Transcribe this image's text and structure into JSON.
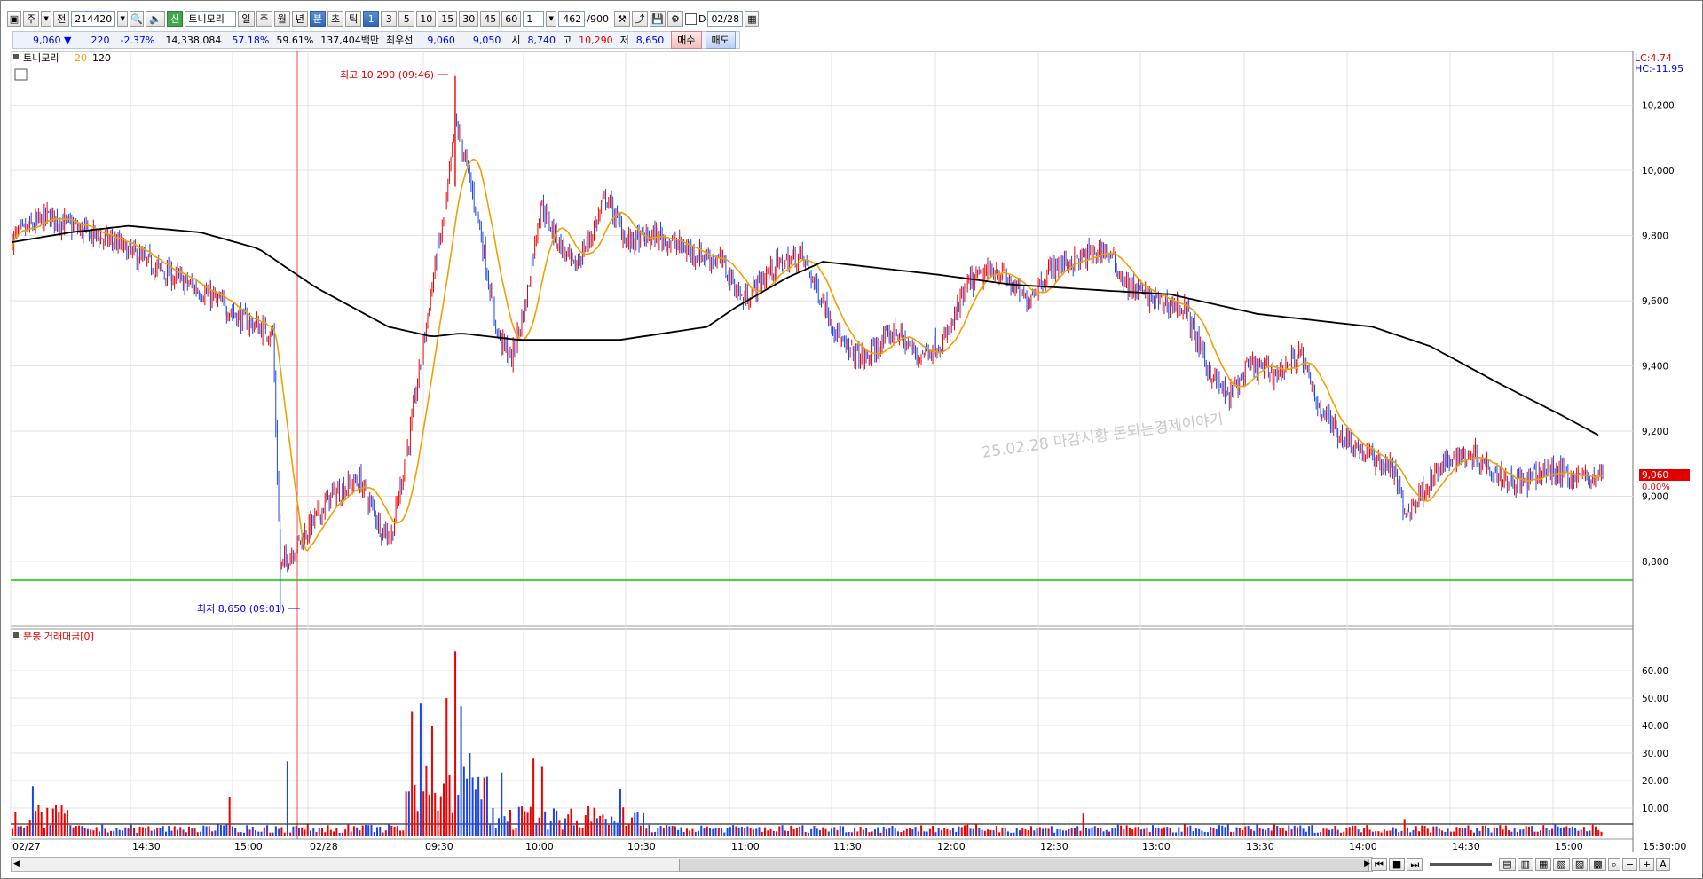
{
  "toolbar": {
    "tab_stock": "주",
    "tab_all": "전",
    "code": "214420",
    "stock_badge": "신",
    "stock_name": "토니모리",
    "periods": [
      "일",
      "주",
      "월",
      "년",
      "분",
      "초",
      "틱"
    ],
    "active_period": "분",
    "minutes": [
      "1",
      "3",
      "5",
      "10",
      "15",
      "30",
      "45",
      "60"
    ],
    "active_minute": "1",
    "unit": "1",
    "count": "462",
    "count_max": "/900",
    "date_label": "D",
    "date": "02/28"
  },
  "quote": {
    "price": "9,060",
    "change": "220",
    "change_pct": "-2.37%",
    "volume": "14,338,084",
    "ratio1": "57.18%",
    "ratio2": "59.61%",
    "amount": "137,404백만",
    "best_label": "최우선",
    "ask": "9,060",
    "bid": "9,050",
    "open_label": "시",
    "open": "8,740",
    "high_label": "고",
    "high": "10,290",
    "low_label": "저",
    "low": "8,650",
    "buy_label": "매수",
    "sell_label": "매도"
  },
  "panels": {
    "price_legend": "토니모리",
    "ma20": "20",
    "ma120": "120",
    "volume_legend": "분봉 거래대금[0]",
    "lc": "LC:4.74",
    "hc": "HC:-11.95",
    "high_marker": "최고 10,290 (09:46)",
    "low_marker": "최저 8,650 (09:01)",
    "watermark": "25.02.28 마감시황 돈되는경제이야기",
    "last_price": "9,060",
    "last_pct": "0.00%",
    "end_time": "15:30:00"
  },
  "colors": {
    "up": "#ee0000",
    "down": "#1a44e6",
    "ma20": "#f0a000",
    "ma120": "#000000",
    "support": "#00cc00"
  },
  "chart_data": {
    "type": "candlestick",
    "price_axis": {
      "min": 8650,
      "max": 10300,
      "ticks": [
        "8,800",
        "9,000",
        "9,200",
        "9,400",
        "9,600",
        "9,800",
        "10,000",
        "10,200"
      ]
    },
    "volume_axis": {
      "min": 0,
      "max": 70,
      "ticks": [
        "10.00",
        "20.00",
        "30.00",
        "40.00",
        "50.00",
        "60.00"
      ]
    },
    "time_labels": [
      "02/27",
      "14:30",
      "15:00",
      "02/28",
      "09:30",
      "10:00",
      "10:30",
      "11:00",
      "11:30",
      "12:00",
      "12:30",
      "13:00",
      "13:30",
      "14:00",
      "14:30",
      "15:00"
    ],
    "support_level": 8740,
    "high": 10290,
    "low": 8650,
    "keyframes": [
      {
        "t": 0,
        "p": 9790
      },
      {
        "t": 10,
        "p": 9820
      },
      {
        "t": 25,
        "p": 9860
      },
      {
        "t": 45,
        "p": 9820
      },
      {
        "t": 70,
        "p": 9780
      },
      {
        "t": 100,
        "p": 9700
      },
      {
        "t": 135,
        "p": 9620
      },
      {
        "t": 160,
        "p": 9540
      },
      {
        "t": 180,
        "p": 9500
      },
      {
        "t": 185,
        "p": 8780
      },
      {
        "t": 200,
        "p": 8870
      },
      {
        "t": 220,
        "p": 9000
      },
      {
        "t": 240,
        "p": 9050
      },
      {
        "t": 255,
        "p": 8900
      },
      {
        "t": 262,
        "p": 8880
      },
      {
        "t": 275,
        "p": 9200
      },
      {
        "t": 290,
        "p": 9650
      },
      {
        "t": 300,
        "p": 9900
      },
      {
        "t": 306,
        "p": 10150
      },
      {
        "t": 312,
        "p": 10050
      },
      {
        "t": 322,
        "p": 9850
      },
      {
        "t": 335,
        "p": 9500
      },
      {
        "t": 345,
        "p": 9420
      },
      {
        "t": 355,
        "p": 9600
      },
      {
        "t": 365,
        "p": 9900
      },
      {
        "t": 375,
        "p": 9800
      },
      {
        "t": 388,
        "p": 9700
      },
      {
        "t": 400,
        "p": 9800
      },
      {
        "t": 410,
        "p": 9920
      },
      {
        "t": 425,
        "p": 9780
      },
      {
        "t": 445,
        "p": 9800
      },
      {
        "t": 470,
        "p": 9750
      },
      {
        "t": 490,
        "p": 9720
      },
      {
        "t": 505,
        "p": 9600
      },
      {
        "t": 525,
        "p": 9700
      },
      {
        "t": 545,
        "p": 9740
      },
      {
        "t": 560,
        "p": 9600
      },
      {
        "t": 575,
        "p": 9450
      },
      {
        "t": 590,
        "p": 9420
      },
      {
        "t": 610,
        "p": 9510
      },
      {
        "t": 625,
        "p": 9430
      },
      {
        "t": 645,
        "p": 9480
      },
      {
        "t": 660,
        "p": 9650
      },
      {
        "t": 680,
        "p": 9700
      },
      {
        "t": 700,
        "p": 9600
      },
      {
        "t": 720,
        "p": 9710
      },
      {
        "t": 740,
        "p": 9730
      },
      {
        "t": 755,
        "p": 9760
      },
      {
        "t": 770,
        "p": 9650
      },
      {
        "t": 790,
        "p": 9600
      },
      {
        "t": 810,
        "p": 9580
      },
      {
        "t": 825,
        "p": 9400
      },
      {
        "t": 840,
        "p": 9300
      },
      {
        "t": 855,
        "p": 9400
      },
      {
        "t": 875,
        "p": 9380
      },
      {
        "t": 890,
        "p": 9440
      },
      {
        "t": 900,
        "p": 9300
      },
      {
        "t": 915,
        "p": 9200
      },
      {
        "t": 935,
        "p": 9130
      },
      {
        "t": 955,
        "p": 9080
      },
      {
        "t": 962,
        "p": 8940
      },
      {
        "t": 980,
        "p": 9050
      },
      {
        "t": 995,
        "p": 9120
      },
      {
        "t": 1010,
        "p": 9130
      },
      {
        "t": 1030,
        "p": 9060
      },
      {
        "t": 1045,
        "p": 9040
      },
      {
        "t": 1060,
        "p": 9080
      },
      {
        "t": 1080,
        "p": 9060
      },
      {
        "t": 1099,
        "p": 9060
      }
    ],
    "ma120_keyframes": [
      {
        "t": 0,
        "p": 9780
      },
      {
        "t": 40,
        "p": 9810
      },
      {
        "t": 80,
        "p": 9830
      },
      {
        "t": 130,
        "p": 9810
      },
      {
        "t": 170,
        "p": 9760
      },
      {
        "t": 210,
        "p": 9640
      },
      {
        "t": 260,
        "p": 9520
      },
      {
        "t": 290,
        "p": 9490
      },
      {
        "t": 310,
        "p": 9500
      },
      {
        "t": 350,
        "p": 9480
      },
      {
        "t": 420,
        "p": 9480
      },
      {
        "t": 480,
        "p": 9520
      },
      {
        "t": 500,
        "p": 9580
      },
      {
        "t": 535,
        "p": 9670
      },
      {
        "t": 560,
        "p": 9720
      },
      {
        "t": 600,
        "p": 9700
      },
      {
        "t": 640,
        "p": 9680
      },
      {
        "t": 690,
        "p": 9650
      },
      {
        "t": 760,
        "p": 9630
      },
      {
        "t": 800,
        "p": 9620
      },
      {
        "t": 860,
        "p": 9560
      },
      {
        "t": 900,
        "p": 9540
      },
      {
        "t": 940,
        "p": 9520
      },
      {
        "t": 980,
        "p": 9460
      },
      {
        "t": 1030,
        "p": 9340
      },
      {
        "t": 1070,
        "p": 9250
      },
      {
        "t": 1099,
        "p": 9180
      }
    ],
    "volume_spikes": [
      {
        "t": 190,
        "v": 27
      },
      {
        "t": 276,
        "v": 45
      },
      {
        "t": 282,
        "v": 48
      },
      {
        "t": 290,
        "v": 40
      },
      {
        "t": 300,
        "v": 50
      },
      {
        "t": 306,
        "v": 67
      },
      {
        "t": 310,
        "v": 47
      },
      {
        "t": 316,
        "v": 30
      },
      {
        "t": 338,
        "v": 23
      },
      {
        "t": 360,
        "v": 28
      },
      {
        "t": 366,
        "v": 25
      },
      {
        "t": 420,
        "v": 17
      },
      {
        "t": 14,
        "v": 18
      },
      {
        "t": 150,
        "v": 14
      },
      {
        "t": 740,
        "v": 8
      },
      {
        "t": 962,
        "v": 6
      }
    ]
  }
}
